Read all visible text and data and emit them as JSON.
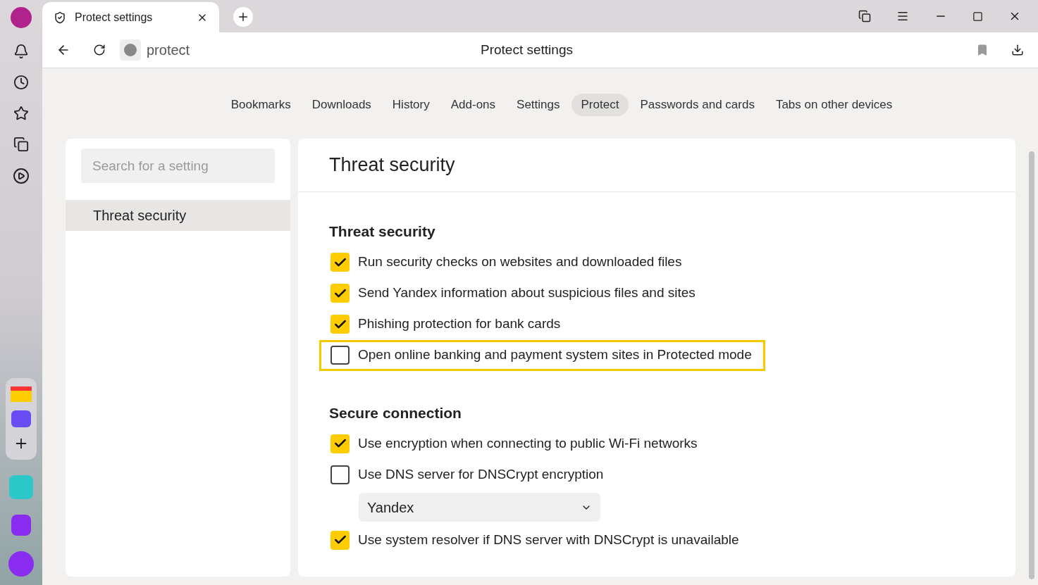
{
  "tab": {
    "title": "Protect settings"
  },
  "address": {
    "url": "protect",
    "page_title": "Protect settings"
  },
  "nav": [
    {
      "label": "Bookmarks",
      "selected": false
    },
    {
      "label": "Downloads",
      "selected": false
    },
    {
      "label": "History",
      "selected": false
    },
    {
      "label": "Add-ons",
      "selected": false
    },
    {
      "label": "Settings",
      "selected": false
    },
    {
      "label": "Protect",
      "selected": true
    },
    {
      "label": "Passwords and cards",
      "selected": false
    },
    {
      "label": "Tabs on other devices",
      "selected": false
    }
  ],
  "sidebar": {
    "search": {
      "placeholder": "Search for a setting"
    },
    "items": [
      {
        "label": "Threat security",
        "selected": true
      }
    ]
  },
  "panel": {
    "title": "Threat security",
    "sections": [
      {
        "heading": "Threat security",
        "items": [
          {
            "kind": "checkbox",
            "label": "Run security checks on websites and downloaded files",
            "checked": true,
            "highlighted": false
          },
          {
            "kind": "checkbox",
            "label": "Send Yandex information about suspicious files and sites",
            "checked": true,
            "highlighted": false
          },
          {
            "kind": "checkbox",
            "label": "Phishing protection for bank cards",
            "checked": true,
            "highlighted": false
          },
          {
            "kind": "checkbox",
            "label": "Open online banking and payment system sites in Protected mode",
            "checked": false,
            "highlighted": true
          }
        ]
      },
      {
        "heading": "Secure connection",
        "items": [
          {
            "kind": "checkbox",
            "label": "Use encryption when connecting to public Wi-Fi networks",
            "checked": true,
            "highlighted": false
          },
          {
            "kind": "checkbox",
            "label": "Use DNS server for DNSCrypt encryption",
            "checked": false,
            "highlighted": false
          },
          {
            "kind": "select",
            "value": "Yandex"
          },
          {
            "kind": "checkbox",
            "label": "Use system resolver if DNS server with DNSCrypt is unavailable",
            "checked": true,
            "highlighted": false
          }
        ]
      }
    ]
  }
}
